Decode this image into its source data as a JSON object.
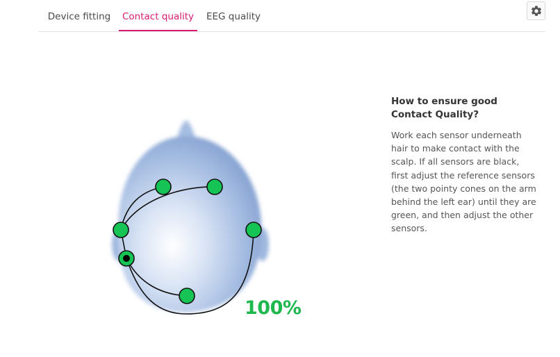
{
  "tabs": [
    {
      "label": "Device fitting",
      "active": false
    },
    {
      "label": "Contact quality",
      "active": true
    },
    {
      "label": "EEG quality",
      "active": false
    }
  ],
  "settings": {
    "icon": "gear-icon"
  },
  "contact": {
    "percentage": "100%",
    "sensors": [
      {
        "status": "good"
      },
      {
        "status": "good"
      },
      {
        "status": "good"
      },
      {
        "status": "good"
      },
      {
        "status": "reference"
      },
      {
        "status": "good"
      }
    ]
  },
  "help": {
    "title": "How to ensure good Contact Quality?",
    "body": "Work each sensor underneath hair to make contact with the scalp. If all sensors are black, first adjust the reference sensors (the two pointy cones on the arm behind the left ear) until they are green, and then adjust the other sensors."
  },
  "colors": {
    "accent": "#d81b72",
    "good": "#1fb84f",
    "head": "#9bb6de"
  }
}
